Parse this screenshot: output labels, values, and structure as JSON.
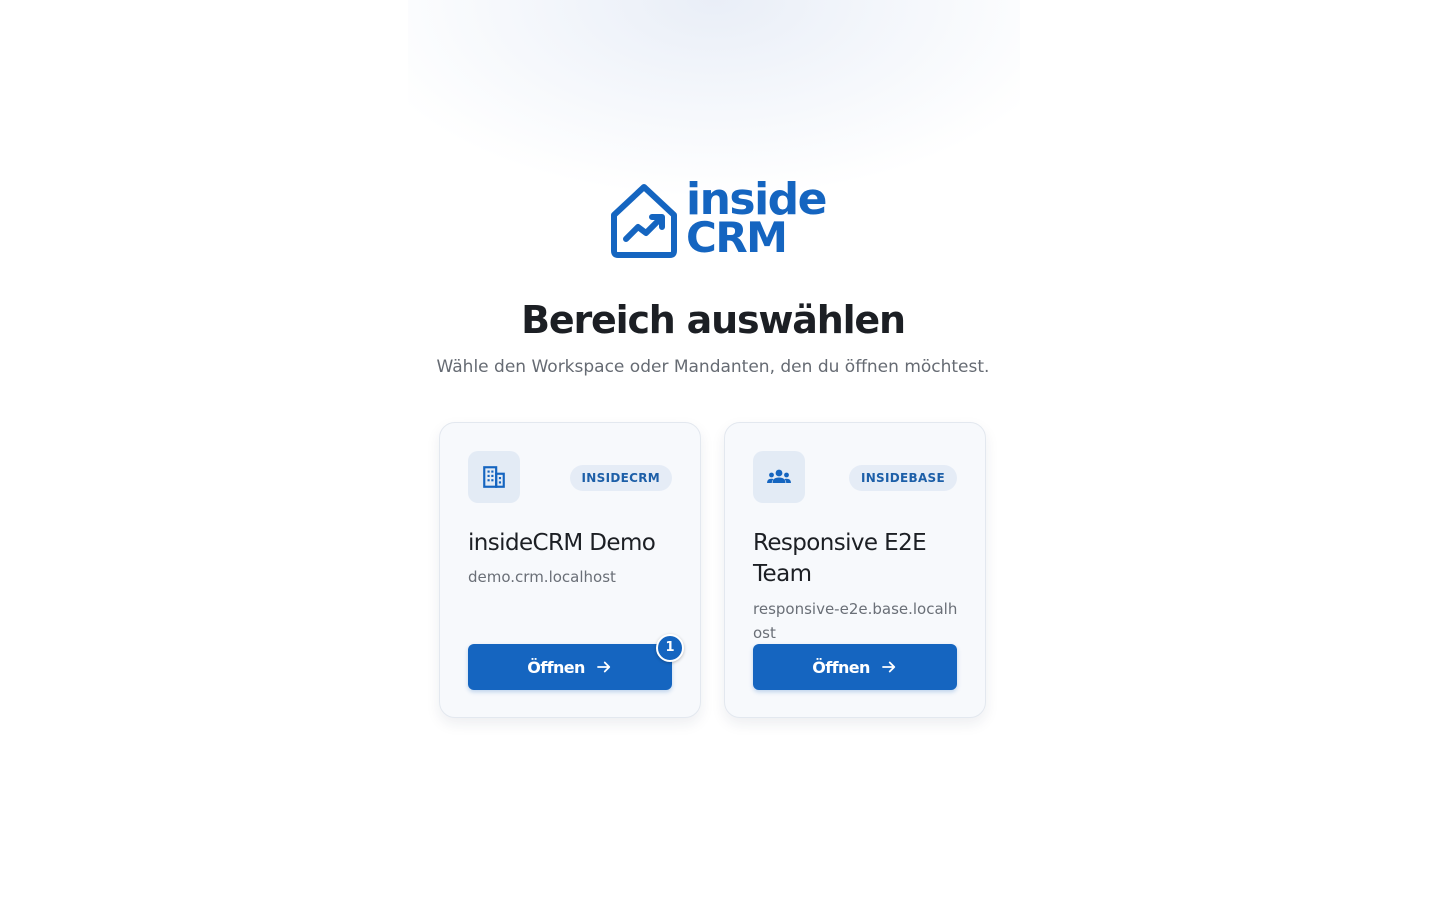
{
  "brand": {
    "line1": "inside",
    "line2": "CRM",
    "color": "#1565c0"
  },
  "header": {
    "title": "Bereich auswählen",
    "subtitle": "Wähle den Workspace oder Mandanten, den du öffnen möchtest."
  },
  "workspaces": [
    {
      "icon": "building-icon",
      "badge": "INSIDECRM",
      "name": "insideCRM Demo",
      "host": "demo.crm.localhost",
      "button_label": "Öffnen",
      "step_marker": "1"
    },
    {
      "icon": "users-icon",
      "badge": "INSIDEBASE",
      "name": "Responsive E2E Team",
      "host": "responsive-e2e.base.localhost",
      "button_label": "Öffnen"
    }
  ]
}
